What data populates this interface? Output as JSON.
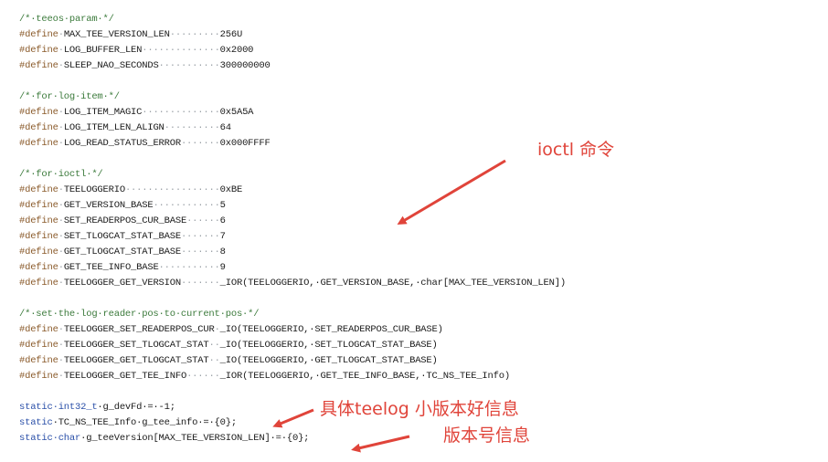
{
  "editor": {
    "lines": [
      {
        "kind": "comment",
        "text": "/*·teeos·param·*/"
      },
      {
        "kind": "define",
        "name": "MAX_TEE_VERSION_LEN",
        "dots": "·········",
        "value": "256U"
      },
      {
        "kind": "define",
        "name": "LOG_BUFFER_LEN",
        "dots": "··············",
        "value": "0x2000"
      },
      {
        "kind": "define",
        "name": "SLEEP_NAO_SECONDS",
        "dots": "···········",
        "value": "300000000"
      },
      {
        "kind": "blank"
      },
      {
        "kind": "comment",
        "text": "/*·for·log·item·*/"
      },
      {
        "kind": "define",
        "name": "LOG_ITEM_MAGIC",
        "dots": "··············",
        "value": "0x5A5A"
      },
      {
        "kind": "define",
        "name": "LOG_ITEM_LEN_ALIGN",
        "dots": "··········",
        "value": "64"
      },
      {
        "kind": "define",
        "name": "LOG_READ_STATUS_ERROR",
        "dots": "·······",
        "value": "0x000FFFF"
      },
      {
        "kind": "blank"
      },
      {
        "kind": "comment",
        "text": "/*·for·ioctl·*/"
      },
      {
        "kind": "define",
        "name": "TEELOGGERIO",
        "dots": "·················",
        "value": "0xBE"
      },
      {
        "kind": "define",
        "name": "GET_VERSION_BASE",
        "dots": "············",
        "value": "5"
      },
      {
        "kind": "define",
        "name": "SET_READERPOS_CUR_BASE",
        "dots": "······",
        "value": "6"
      },
      {
        "kind": "define",
        "name": "SET_TLOGCAT_STAT_BASE",
        "dots": "·······",
        "value": "7"
      },
      {
        "kind": "define",
        "name": "GET_TLOGCAT_STAT_BASE",
        "dots": "·······",
        "value": "8"
      },
      {
        "kind": "define",
        "name": "GET_TEE_INFO_BASE",
        "dots": "···········",
        "value": "9"
      },
      {
        "kind": "define",
        "name": "TEELOGGER_GET_VERSION",
        "dots": "·······",
        "value": "_IOR(TEELOGGERIO,·GET_VERSION_BASE,·char[MAX_TEE_VERSION_LEN])"
      },
      {
        "kind": "blank"
      },
      {
        "kind": "comment",
        "text": "/*·set·the·log·reader·pos·to·current·pos·*/"
      },
      {
        "kind": "define",
        "name": "TEELOGGER_SET_READERPOS_CUR",
        "dots": "·",
        "value": "_IO(TEELOGGERIO,·SET_READERPOS_CUR_BASE)"
      },
      {
        "kind": "define",
        "name": "TEELOGGER_SET_TLOGCAT_STAT",
        "dots": "··",
        "value": "_IO(TEELOGGERIO,·SET_TLOGCAT_STAT_BASE)"
      },
      {
        "kind": "define",
        "name": "TEELOGGER_GET_TLOGCAT_STAT",
        "dots": "··",
        "value": "_IO(TEELOGGERIO,·GET_TLOGCAT_STAT_BASE)"
      },
      {
        "kind": "define",
        "name": "TEELOGGER_GET_TEE_INFO",
        "dots": "······",
        "value": "_IOR(TEELOGGERIO,·GET_TEE_INFO_BASE,·TC_NS_TEE_Info)"
      },
      {
        "kind": "blank"
      },
      {
        "kind": "decl",
        "kw": "static·int32_t",
        "rest": "·g_devFd·=·-1;"
      },
      {
        "kind": "decl",
        "kw": "static",
        "rest": "·TC_NS_TEE_Info·g_tee_info·=·{0};"
      },
      {
        "kind": "decl",
        "kw": "static·char",
        "rest": "·g_teeVersion[MAX_TEE_VERSION_LEN]·=·{0};"
      }
    ]
  },
  "annotations": {
    "ioctl_label": "ioctl 命令",
    "tee_info_label": "具体teelog 小版本好信息",
    "version_label": "版本号信息"
  },
  "colors": {
    "annotation": "#e0443a",
    "comment": "#3b7a3b",
    "keyword": "#2a4fa8",
    "preprocessor": "#8a5a2a"
  }
}
